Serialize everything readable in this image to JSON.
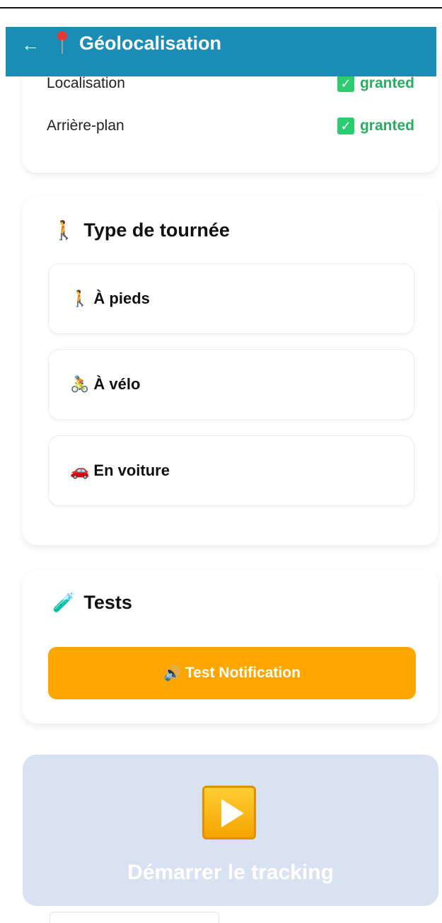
{
  "header": {
    "back_icon": "arrow-left-icon",
    "back_glyph": "←",
    "pin_icon": "map-pin-icon",
    "title": "Géolocalisation",
    "color": "#1a8db6"
  },
  "permissions": {
    "rows": [
      {
        "label": "Localisation",
        "status": "granted"
      },
      {
        "label": "Arrière-plan",
        "status": "granted"
      }
    ],
    "check_glyph": "✓",
    "status_color": "#27ae60"
  },
  "tour_type": {
    "emoji": "🚶",
    "title": "Type de tournée",
    "options": [
      {
        "emoji": "🚶",
        "label": "À pieds"
      },
      {
        "emoji": "🚴",
        "label": "À vélo"
      },
      {
        "emoji": "🚗",
        "label": "En voiture"
      }
    ]
  },
  "tests": {
    "emoji": "🧪",
    "title": "Tests",
    "button_emoji": "🔊",
    "button_label": "Test Notification",
    "button_color": "#ffa500"
  },
  "tracking": {
    "icon": "play-button-icon",
    "label": "Démarrer le tracking",
    "panel_color": "#d9e2f0"
  }
}
